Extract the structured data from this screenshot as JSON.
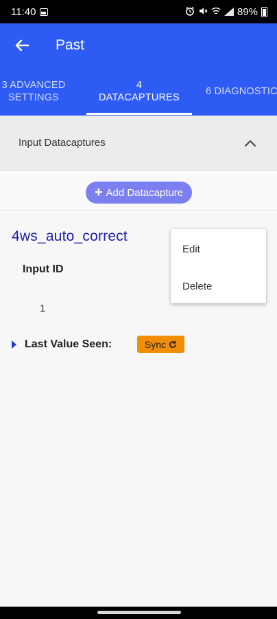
{
  "status_bar": {
    "time": "11:40",
    "battery": "89%",
    "icons": [
      "gallery-icon",
      "alarm-icon",
      "mute-icon",
      "wifi-icon",
      "signal-icon",
      "battery-icon"
    ]
  },
  "app_bar": {
    "title": "Past",
    "back_icon": "arrow-left-icon"
  },
  "tabs": [
    {
      "label": "3 ADVANCED\nSETTINGS",
      "active": false
    },
    {
      "label": "4\nDATACAPTURES",
      "active": true
    },
    {
      "label": "6 DIAGNOSTIC",
      "active": false
    }
  ],
  "section": {
    "title": "Input Datacaptures",
    "collapse_icon": "chevron-up-icon"
  },
  "add_button": {
    "icon": "plus-icon",
    "label": "Add Datacapture"
  },
  "capture": {
    "name": "4ws_auto_correct",
    "input_id_label": "Input ID",
    "input_id_value": "1",
    "last_value_label": "Last Value Seen:",
    "sync_label": "Sync",
    "sync_icon": "refresh-icon"
  },
  "menu": {
    "edit_label": "Edit",
    "delete_label": "Delete"
  },
  "colors": {
    "primary": "#2f5bf5",
    "accent_button": "#7b7ff0",
    "capture_title": "#1d22a8",
    "sync": "#f18d07"
  }
}
